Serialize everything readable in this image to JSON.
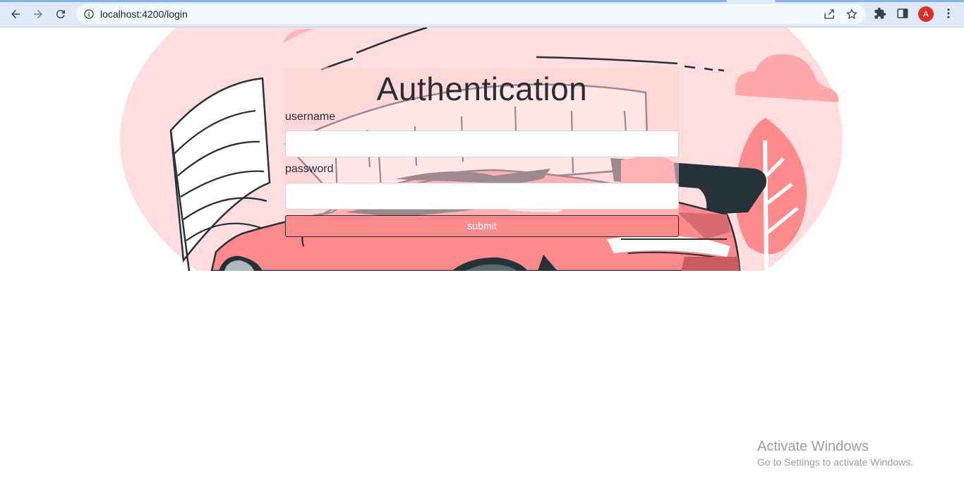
{
  "browser": {
    "url": "localhost:4200/login",
    "profile_initial": "A",
    "icons": {
      "back": "back-arrow-icon",
      "forward": "forward-arrow-icon",
      "reload": "reload-icon",
      "site_info": "info-icon",
      "share": "share-icon",
      "bookmark": "star-icon",
      "extensions": "puzzle-icon",
      "side_panel": "side-panel-icon",
      "menu": "kebab-menu-icon"
    },
    "profile_color": "#d93025"
  },
  "form": {
    "title": "Authentication",
    "username_label": "username",
    "username_value": "",
    "password_label": "password",
    "password_value": "",
    "submit_label": "submit",
    "button_color": "#fd8a8d"
  },
  "watermark": {
    "line1": "Activate Windows",
    "line2": "Go to Settings to activate Windows."
  },
  "colors": {
    "hero_background": "#ffdcdd",
    "car_body": "#fd8a8d",
    "outline": "#263238"
  }
}
